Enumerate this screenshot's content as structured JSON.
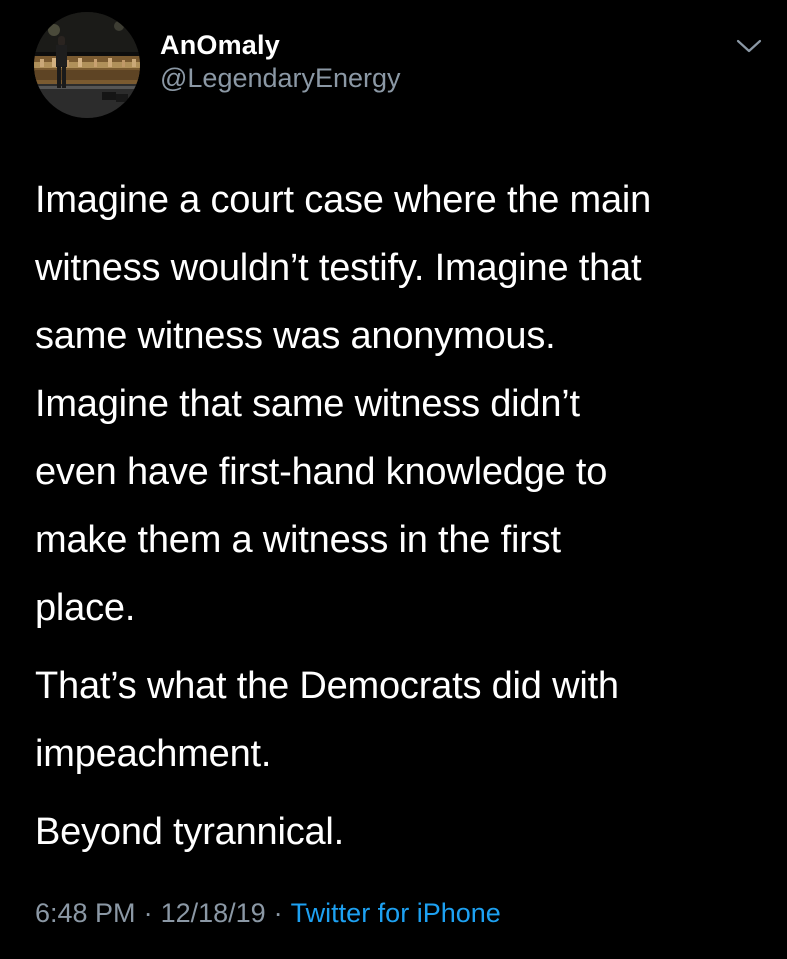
{
  "user": {
    "display_name": "AnOmaly",
    "handle": "@LegendaryEnergy"
  },
  "tweet": {
    "paragraphs": [
      "Imagine a court case where the main\nwitness wouldn’t testify. Imagine that\nsame witness was anonymous.\nImagine that same witness didn’t\neven have first-hand knowledge to\nmake them a witness in the first\nplace.",
      "That’s what the Democrats did with\nimpeachment.",
      "Beyond tyrannical."
    ]
  },
  "meta": {
    "time": "6:48 PM",
    "separator": "·",
    "date": "12/18/19",
    "source": "Twitter for iPhone"
  },
  "icons": {
    "menu": "chevron-down-icon",
    "avatar": "concert-stage-photo"
  },
  "colors": {
    "background": "#000000",
    "text": "#ffffff",
    "secondary": "#8b98a5",
    "link": "#1da1f2"
  }
}
